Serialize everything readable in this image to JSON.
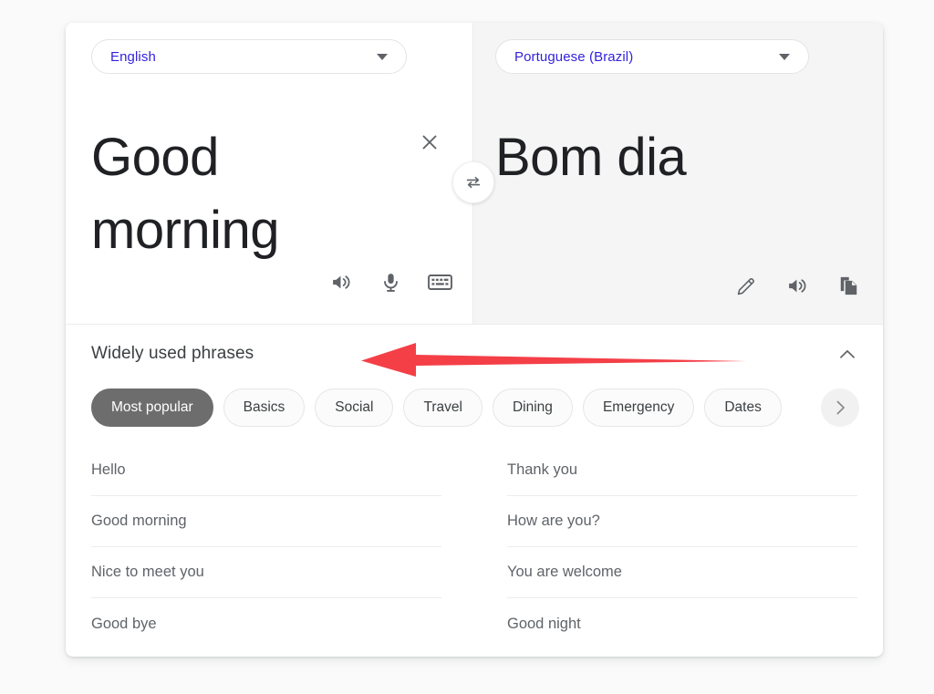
{
  "source_panel": {
    "language": "English",
    "text": "Good morning",
    "clear_label": "×",
    "icons": [
      {
        "name": "listen-icon",
        "label": "Listen"
      },
      {
        "name": "microphone-icon",
        "label": "Speak"
      },
      {
        "name": "keyboard-icon",
        "label": "Keyboard"
      }
    ]
  },
  "target_panel": {
    "language": "Portuguese (Brazil)",
    "text": "Bom dia",
    "icons": [
      {
        "name": "edit-pencil-icon",
        "label": "Edit"
      },
      {
        "name": "listen-icon",
        "label": "Listen"
      },
      {
        "name": "copy-icon",
        "label": "Copy translation"
      }
    ]
  },
  "swap": {
    "name": "swap-languages-button",
    "label": "Swap languages"
  },
  "phrases": {
    "title": "Widely used phrases",
    "collapse_label": "Collapse",
    "next_label": "Next categories",
    "categories": [
      {
        "label": "Most popular",
        "selected": true
      },
      {
        "label": "Basics",
        "selected": false
      },
      {
        "label": "Social",
        "selected": false
      },
      {
        "label": "Travel",
        "selected": false
      },
      {
        "label": "Dining",
        "selected": false
      },
      {
        "label": "Emergency",
        "selected": false
      },
      {
        "label": "Dates",
        "selected": false
      }
    ],
    "column_left": [
      "Hello",
      "Good morning",
      "Nice to meet you",
      "Good bye"
    ],
    "column_right": [
      "Thank you",
      "How are you?",
      "You are welcome",
      "Good night"
    ]
  },
  "annotation": {
    "name": "red-arrow-annotation",
    "direction": "left",
    "color": "#f43f47",
    "points_at": "Widely used phrases"
  },
  "colors": {
    "page_background": "#fafafa",
    "card_background": "#ffffff",
    "target_panel_background": "#f5f5f5",
    "language_link": "#3322dd",
    "chip_selected": "#6d6d6d",
    "icon_gray": "#5f6368",
    "annotation_red": "#f43f47"
  }
}
